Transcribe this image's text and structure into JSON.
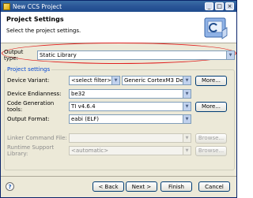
{
  "window": {
    "title": "New CCS Project",
    "min": "_",
    "max": "□",
    "close": "×"
  },
  "header": {
    "title": "Project Settings",
    "subtitle": "Select the project settings."
  },
  "output_type": {
    "label": "Output type:",
    "value": "Static Library"
  },
  "group": {
    "title": "Project settings",
    "device_variant": {
      "label": "Device Variant:",
      "filter": "<select filter>",
      "value": "Generic CortexM3 Device",
      "more": "More..."
    },
    "device_endianness": {
      "label": "Device Endianness:",
      "value": "be32"
    },
    "codegen_tools": {
      "label": "Code Generation tools:",
      "value": "TI v4.6.4",
      "more": "More..."
    },
    "output_format": {
      "label": "Output Format:",
      "value": "eabi (ELF)"
    },
    "linker_cmd": {
      "label": "Linker Command File:",
      "value": "",
      "browse": "Browse..."
    },
    "runtime_lib": {
      "label": "Runtime Support Library:",
      "value": "<automatic>",
      "browse": "Browse..."
    }
  },
  "footer": {
    "help": "?",
    "back": "< Back",
    "next": "Next >",
    "finish": "Finish",
    "cancel": "Cancel"
  },
  "colors": {
    "highlight": "#e02020",
    "group_title": "#0046d5"
  },
  "icons": {
    "banner": "ccs-project-icon",
    "help": "help-icon"
  }
}
